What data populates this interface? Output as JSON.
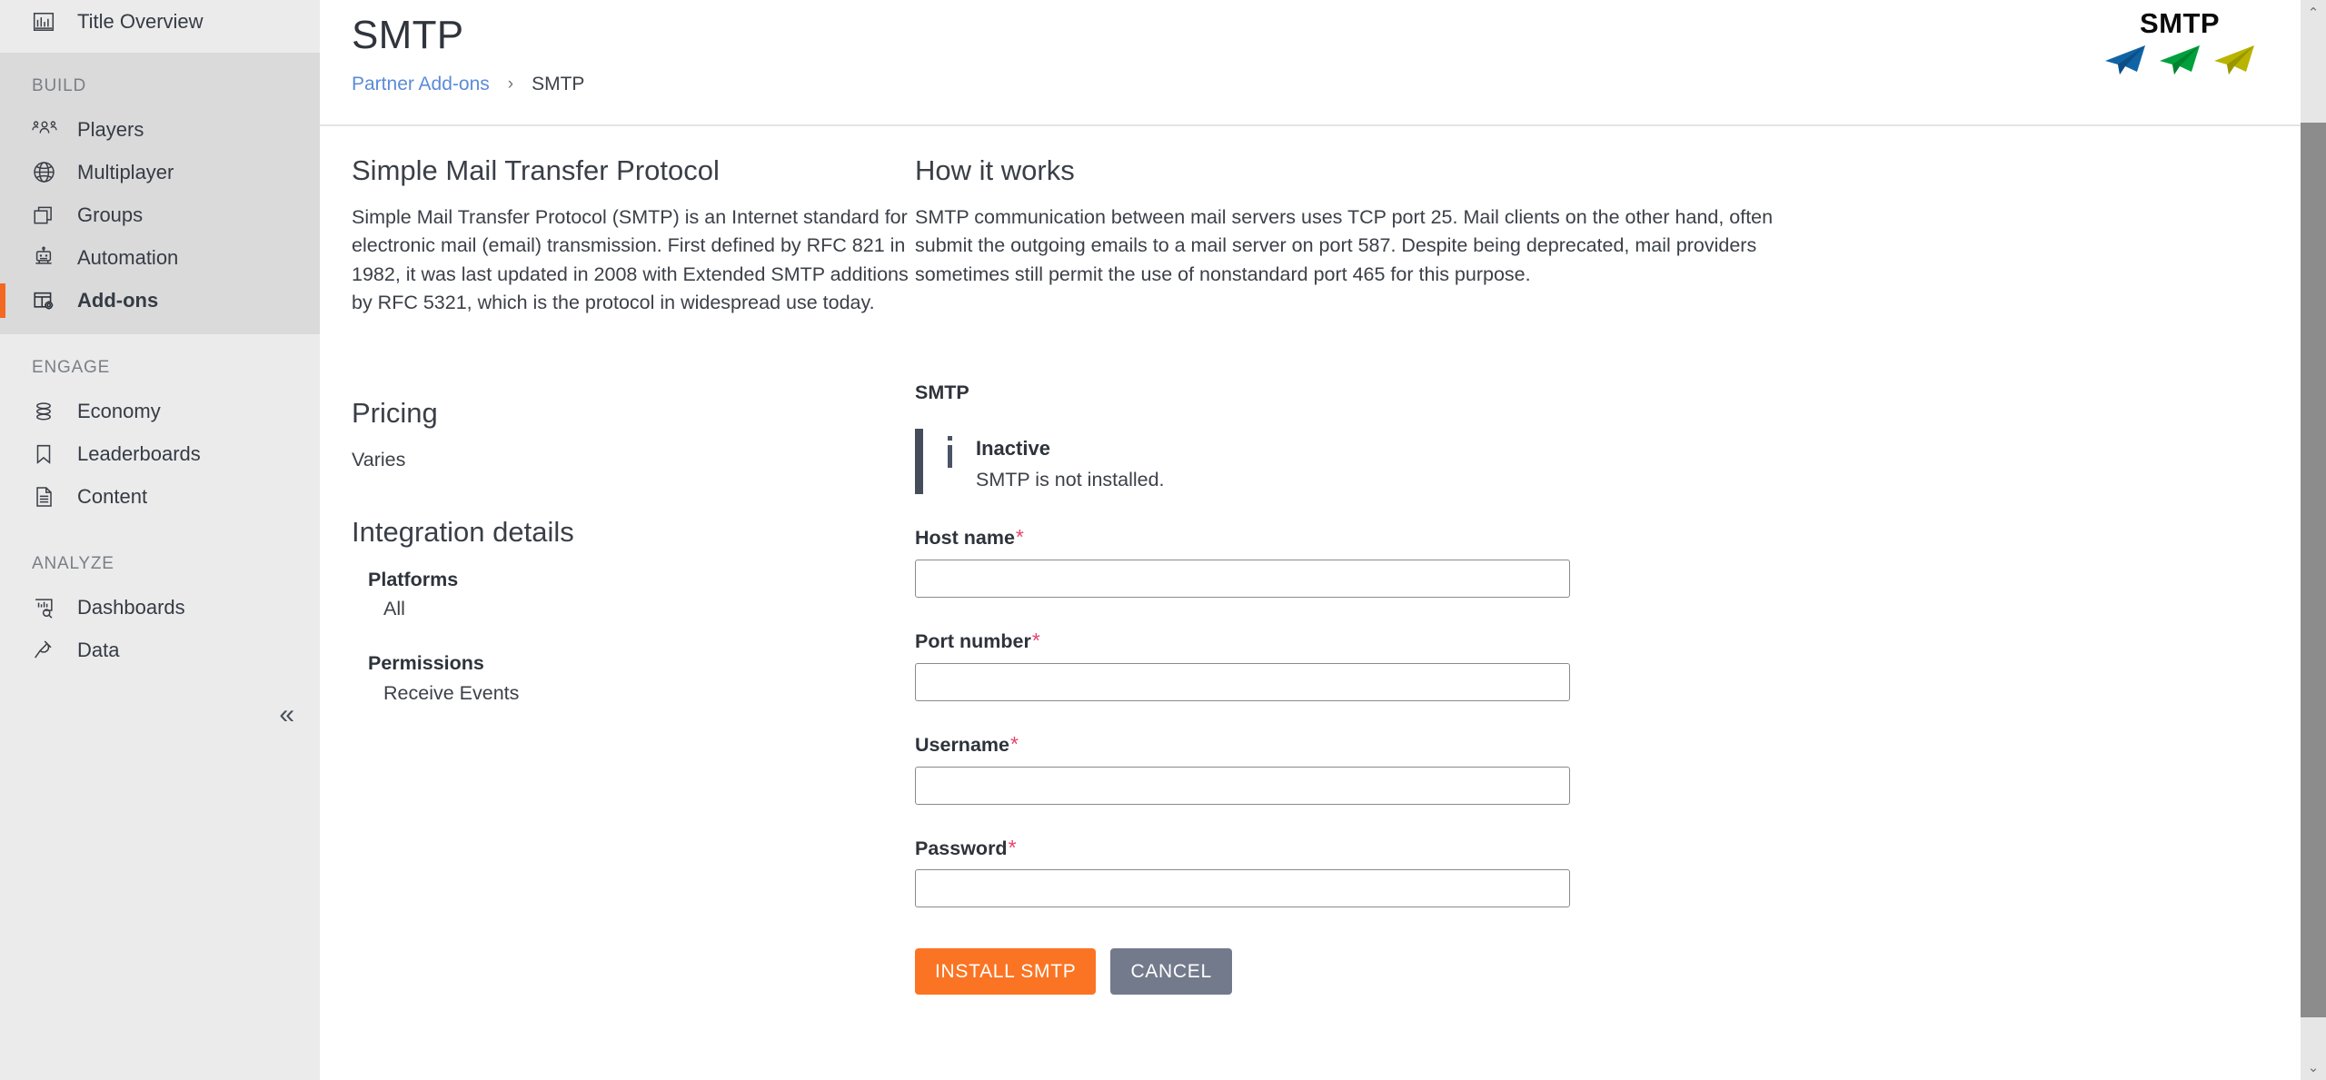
{
  "sidebar": {
    "top_item": {
      "label": "Title Overview",
      "icon": "bar-chart-icon"
    },
    "sections": [
      {
        "label": "BUILD",
        "active": true,
        "items": [
          {
            "label": "Players",
            "icon": "players-icon",
            "current": false
          },
          {
            "label": "Multiplayer",
            "icon": "globe-icon",
            "current": false
          },
          {
            "label": "Groups",
            "icon": "groups-icon",
            "current": false
          },
          {
            "label": "Automation",
            "icon": "robot-icon",
            "current": false
          },
          {
            "label": "Add-ons",
            "icon": "addons-icon",
            "current": true
          }
        ]
      },
      {
        "label": "ENGAGE",
        "active": false,
        "items": [
          {
            "label": "Economy",
            "icon": "coins-icon",
            "current": false
          },
          {
            "label": "Leaderboards",
            "icon": "bookmark-icon",
            "current": false
          },
          {
            "label": "Content",
            "icon": "document-icon",
            "current": false
          }
        ]
      },
      {
        "label": "ANALYZE",
        "active": false,
        "items": [
          {
            "label": "Dashboards",
            "icon": "dashboards-icon",
            "current": false
          },
          {
            "label": "Data",
            "icon": "plug-icon",
            "current": false
          }
        ]
      }
    ],
    "collapse_glyph": "«",
    "collapse_name": "collapse-sidebar"
  },
  "header": {
    "title": "SMTP",
    "breadcrumb": {
      "parent": "Partner Add-ons",
      "separator": "›",
      "current": "SMTP"
    },
    "logo": {
      "text": "SMTP",
      "plane_colors": [
        "#1064a5",
        "#00a03c",
        "#a8a400"
      ]
    }
  },
  "left_column": {
    "overview_heading": "Simple Mail Transfer Protocol",
    "overview_body": "Simple Mail Transfer Protocol (SMTP) is an Internet standard for electronic mail (email) transmission. First defined by RFC 821 in 1982, it was last updated in 2008 with Extended SMTP additions by RFC 5321, which is the protocol in widespread use today.",
    "pricing_heading": "Pricing",
    "pricing_value": "Varies",
    "integration_heading": "Integration details",
    "details": [
      {
        "label": "Platforms",
        "value": "All"
      },
      {
        "label": "Permissions",
        "value": "Receive Events"
      }
    ]
  },
  "right_column": {
    "how_heading": "How it works",
    "how_body": "SMTP communication between mail servers uses TCP port 25. Mail clients on the other hand, often submit the outgoing emails to a mail server on port 587. Despite being deprecated, mail providers sometimes still permit the use of nonstandard port 465 for this purpose.",
    "form_title": "SMTP",
    "status": {
      "icon": "info-icon",
      "title": "Inactive",
      "description": "SMTP is not installed.",
      "bar_color": "#464d5a"
    },
    "fields": [
      {
        "label": "Host name",
        "required": "*",
        "value": "",
        "placeholder": "",
        "type": "text",
        "name": "host-name-input"
      },
      {
        "label": "Port number",
        "required": "*",
        "value": "",
        "placeholder": "",
        "type": "text",
        "name": "port-number-input"
      },
      {
        "label": "Username",
        "required": "*",
        "value": "",
        "placeholder": "",
        "type": "text",
        "name": "username-input"
      },
      {
        "label": "Password",
        "required": "*",
        "value": "",
        "placeholder": "",
        "type": "password",
        "name": "password-input"
      }
    ],
    "buttons": {
      "install": "INSTALL SMTP",
      "cancel": "CANCEL",
      "install_color": "#fa7423",
      "cancel_color": "#737a8c"
    }
  },
  "scrollbar": {
    "up_glyph": "⌃",
    "down_glyph": "⌄"
  }
}
